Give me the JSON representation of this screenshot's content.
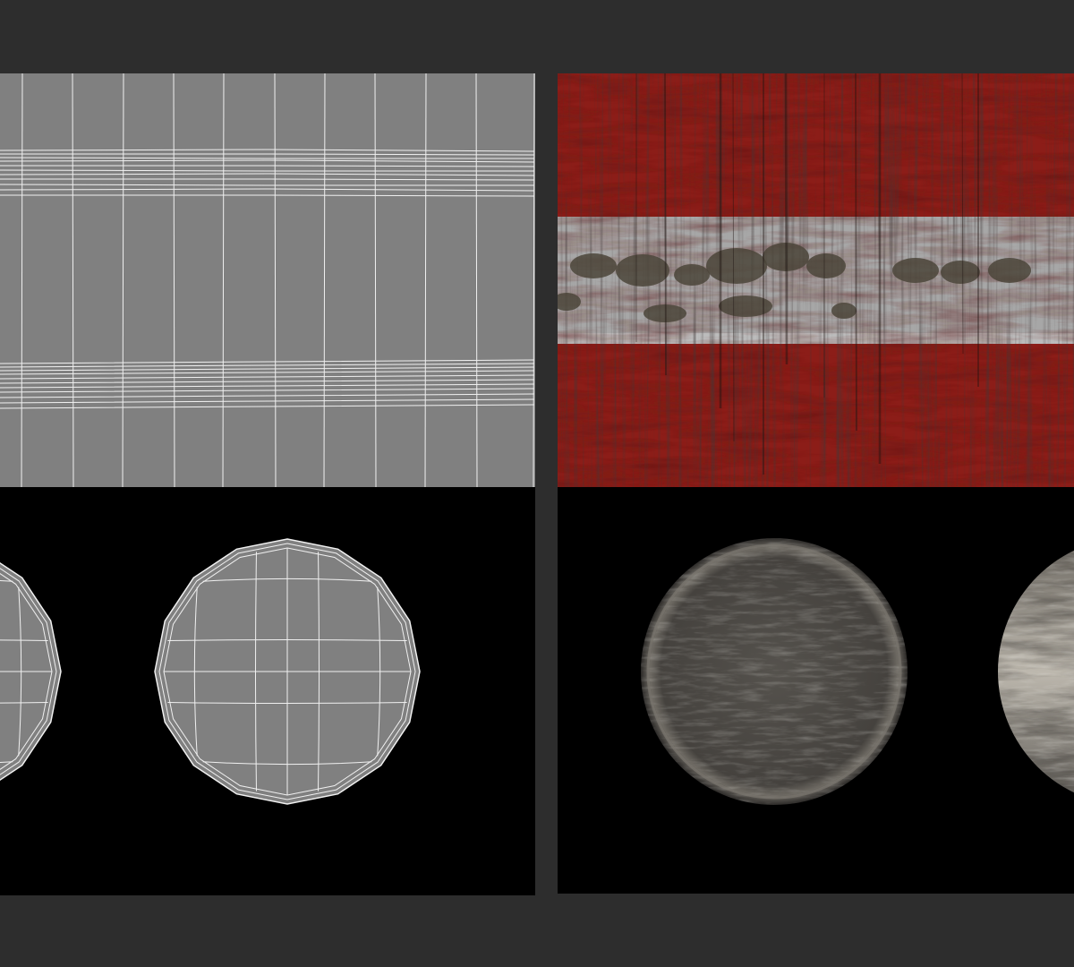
{
  "page": {
    "background_color": "#2d2d2d"
  },
  "uv_layout_panel": {
    "top_island_fill": "#808080",
    "wire_color": "#f0f0f0",
    "background_color": "#000000",
    "cylinder_cap_islands": 2
  },
  "texture_panel": {
    "paint_red": "#8c1d18",
    "stripe_gray": "#a7a7a7",
    "cap_metal": "#4a4743",
    "background_color": "#000000",
    "cylinder_cap_textures": 2
  },
  "icons": []
}
